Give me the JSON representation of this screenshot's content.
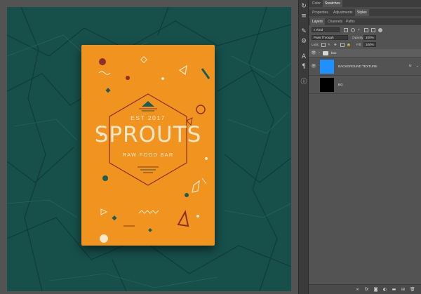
{
  "document": {
    "box": {
      "est_text": "EST 2017",
      "brand_text": "SPROUTS",
      "tagline_text": "RAW FOOD BAR",
      "colors": {
        "box": "#f0941f",
        "cream": "#fbe7c9",
        "teal": "#1b5d56",
        "maroon": "#8e2f2a",
        "background": "#174f4a"
      }
    }
  },
  "panel_group_1": {
    "tabs": [
      {
        "label": "Color"
      },
      {
        "label": "Swatches"
      }
    ]
  },
  "panel_group_2": {
    "tabs": [
      {
        "label": "Properties"
      },
      {
        "label": "Adjustments"
      },
      {
        "label": "Styles"
      }
    ]
  },
  "layers_panel": {
    "tabs": [
      {
        "label": "Layers"
      },
      {
        "label": "Channels"
      },
      {
        "label": "Paths"
      }
    ],
    "filter_kind": "Kind",
    "blend_mode": "Pass Through",
    "opacity_label": "Opacity:",
    "opacity_value": "100%",
    "lock_label": "Lock:",
    "fill_label": "Fill:",
    "fill_value": "100%",
    "layers": [
      {
        "name": "box",
        "type": "group"
      },
      {
        "name": "BACKGROUND TEXTURE",
        "type": "smart-object",
        "fx": "fx"
      },
      {
        "name": "BG",
        "type": "fill"
      }
    ]
  }
}
